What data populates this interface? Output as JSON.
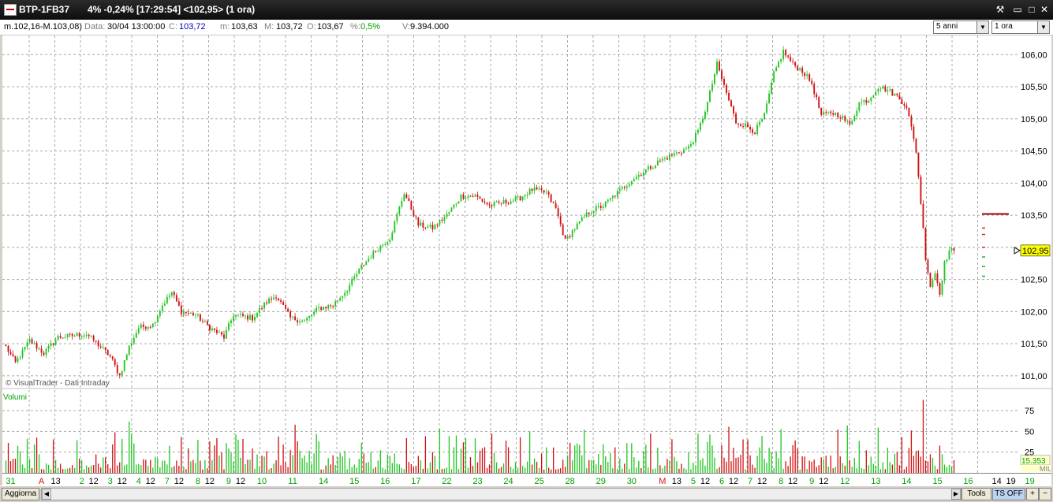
{
  "window": {
    "symbol": "BTP-1FB37",
    "quote": "4% -0,24% [17:29:54]  <102,95> (1 ora)",
    "minimize": "▭",
    "maximize": "□",
    "close": "✕",
    "tool": "⚒"
  },
  "info": {
    "range": "m.102,16-M.103,08)",
    "data_label": "Data:",
    "data_value": "30/04 13:00:00",
    "c_label": "C:",
    "c_value": "103,72",
    "m_label": "m:",
    "m_value": "103,63",
    "M_label": "M:",
    "M_value": "103,72",
    "o_label": "O:",
    "o_value": "103,67",
    "pct_label": "%:",
    "pct_value": "0,5%",
    "v_label": "V:",
    "v_value": "9.394.000"
  },
  "selects": {
    "period": "5 anni",
    "interval": "1 ora"
  },
  "bottom": {
    "aggiorna": "Aggiorna",
    "tools": "Tools",
    "ts_off": "TS OFF",
    "plus": "+",
    "minus": "−"
  },
  "colors": {
    "up": "#22c422",
    "down": "#d01010",
    "grid": "#a8a8a8",
    "price_tag": "#ffff00",
    "volumi_label": "#00a000"
  },
  "chart_data": [
    {
      "type": "candlestick",
      "title": "",
      "watermark": "© VisualTrader - Dati Intraday",
      "ylim": [
        100.9,
        106.2
      ],
      "yticks": [
        "101,00",
        "101,50",
        "102,00",
        "102,50",
        "103,00",
        "103,50",
        "104,00",
        "104,50",
        "105,00",
        "105,50",
        "106,00"
      ],
      "yticks_values": [
        101.0,
        101.5,
        102.0,
        102.5,
        103.0,
        103.5,
        104.0,
        104.5,
        105.0,
        105.5,
        106.0
      ],
      "last_price_label": "102,95",
      "last_price": 102.95,
      "anchors": [
        {
          "bar": 0,
          "price": 101.45
        },
        {
          "bar": 4,
          "price": 101.2
        },
        {
          "bar": 10,
          "price": 101.55
        },
        {
          "bar": 16,
          "price": 101.35
        },
        {
          "bar": 22,
          "price": 101.6
        },
        {
          "bar": 34,
          "price": 101.65
        },
        {
          "bar": 40,
          "price": 101.45
        },
        {
          "bar": 44,
          "price": 101.3
        },
        {
          "bar": 48,
          "price": 101.0
        },
        {
          "bar": 52,
          "price": 101.45
        },
        {
          "bar": 56,
          "price": 101.75
        },
        {
          "bar": 62,
          "price": 101.8
        },
        {
          "bar": 66,
          "price": 102.1
        },
        {
          "bar": 70,
          "price": 102.3
        },
        {
          "bar": 74,
          "price": 102.0
        },
        {
          "bar": 80,
          "price": 101.95
        },
        {
          "bar": 86,
          "price": 101.75
        },
        {
          "bar": 92,
          "price": 101.6
        },
        {
          "bar": 96,
          "price": 101.95
        },
        {
          "bar": 104,
          "price": 101.9
        },
        {
          "bar": 110,
          "price": 102.15
        },
        {
          "bar": 114,
          "price": 102.25
        },
        {
          "bar": 120,
          "price": 101.9
        },
        {
          "bar": 126,
          "price": 101.85
        },
        {
          "bar": 132,
          "price": 102.05
        },
        {
          "bar": 138,
          "price": 102.1
        },
        {
          "bar": 144,
          "price": 102.35
        },
        {
          "bar": 150,
          "price": 102.7
        },
        {
          "bar": 156,
          "price": 102.95
        },
        {
          "bar": 162,
          "price": 103.15
        },
        {
          "bar": 168,
          "price": 103.85
        },
        {
          "bar": 174,
          "price": 103.35
        },
        {
          "bar": 180,
          "price": 103.3
        },
        {
          "bar": 186,
          "price": 103.5
        },
        {
          "bar": 192,
          "price": 103.8
        },
        {
          "bar": 198,
          "price": 103.8
        },
        {
          "bar": 204,
          "price": 103.65
        },
        {
          "bar": 210,
          "price": 103.7
        },
        {
          "bar": 216,
          "price": 103.75
        },
        {
          "bar": 222,
          "price": 103.9
        },
        {
          "bar": 228,
          "price": 103.85
        },
        {
          "bar": 232,
          "price": 103.6
        },
        {
          "bar": 236,
          "price": 103.1
        },
        {
          "bar": 240,
          "price": 103.3
        },
        {
          "bar": 246,
          "price": 103.55
        },
        {
          "bar": 252,
          "price": 103.65
        },
        {
          "bar": 258,
          "price": 103.85
        },
        {
          "bar": 264,
          "price": 104.05
        },
        {
          "bar": 270,
          "price": 104.2
        },
        {
          "bar": 276,
          "price": 104.35
        },
        {
          "bar": 282,
          "price": 104.45
        },
        {
          "bar": 288,
          "price": 104.55
        },
        {
          "bar": 292,
          "price": 104.8
        },
        {
          "bar": 296,
          "price": 105.25
        },
        {
          "bar": 300,
          "price": 105.85
        },
        {
          "bar": 304,
          "price": 105.4
        },
        {
          "bar": 308,
          "price": 104.95
        },
        {
          "bar": 312,
          "price": 104.9
        },
        {
          "bar": 316,
          "price": 104.8
        },
        {
          "bar": 320,
          "price": 105.05
        },
        {
          "bar": 324,
          "price": 105.7
        },
        {
          "bar": 328,
          "price": 106.05
        },
        {
          "bar": 332,
          "price": 105.85
        },
        {
          "bar": 336,
          "price": 105.75
        },
        {
          "bar": 340,
          "price": 105.55
        },
        {
          "bar": 344,
          "price": 105.05
        },
        {
          "bar": 348,
          "price": 105.1
        },
        {
          "bar": 352,
          "price": 105.05
        },
        {
          "bar": 356,
          "price": 104.9
        },
        {
          "bar": 360,
          "price": 105.25
        },
        {
          "bar": 364,
          "price": 105.3
        },
        {
          "bar": 368,
          "price": 105.5
        },
        {
          "bar": 372,
          "price": 105.45
        },
        {
          "bar": 376,
          "price": 105.35
        },
        {
          "bar": 380,
          "price": 105.2
        },
        {
          "bar": 384,
          "price": 104.5
        },
        {
          "bar": 386,
          "price": 103.7
        },
        {
          "bar": 388,
          "price": 102.85
        },
        {
          "bar": 390,
          "price": 102.4
        },
        {
          "bar": 392,
          "price": 102.6
        },
        {
          "bar": 394,
          "price": 102.3
        },
        {
          "bar": 396,
          "price": 102.75
        },
        {
          "bar": 398,
          "price": 102.95
        },
        {
          "bar": 400,
          "price": 102.95
        }
      ],
      "bar_count": 401,
      "pending_markers": [
        103.52,
        103.3,
        103.2,
        103.0,
        102.85,
        102.7,
        102.55
      ]
    },
    {
      "type": "bar",
      "title": "Volumi",
      "ylim": [
        0,
        95
      ],
      "yticks": [
        "25",
        "50",
        "75"
      ],
      "yticks_values": [
        25,
        50,
        75
      ],
      "unit_label": "MIL",
      "last_value_label": "15.353",
      "last_value": 15.353,
      "peak_value": 88,
      "peak_bar": 387
    }
  ],
  "x_axis": {
    "labels": [
      {
        "bar": 2,
        "text": "31",
        "color": "#00a000"
      },
      {
        "bar": 15,
        "text": "A",
        "color": "#d01010"
      },
      {
        "bar": 21,
        "text": "13",
        "color": "#000000"
      },
      {
        "bar": 32,
        "text": "2",
        "color": "#00a000"
      },
      {
        "bar": 37,
        "text": "12",
        "color": "#000000"
      },
      {
        "bar": 44,
        "text": "3",
        "color": "#00a000"
      },
      {
        "bar": 49,
        "text": "12",
        "color": "#000000"
      },
      {
        "bar": 56,
        "text": "4",
        "color": "#00a000"
      },
      {
        "bar": 61,
        "text": "12",
        "color": "#000000"
      },
      {
        "bar": 68,
        "text": "7",
        "color": "#00a000"
      },
      {
        "bar": 73,
        "text": "12",
        "color": "#000000"
      },
      {
        "bar": 81,
        "text": "8",
        "color": "#00a000"
      },
      {
        "bar": 86,
        "text": "12",
        "color": "#000000"
      },
      {
        "bar": 94,
        "text": "9",
        "color": "#00a000"
      },
      {
        "bar": 99,
        "text": "12",
        "color": "#000000"
      },
      {
        "bar": 108,
        "text": "10",
        "color": "#00a000"
      },
      {
        "bar": 121,
        "text": "11",
        "color": "#00a000"
      },
      {
        "bar": 134,
        "text": "14",
        "color": "#00a000"
      },
      {
        "bar": 147,
        "text": "15",
        "color": "#00a000"
      },
      {
        "bar": 160,
        "text": "16",
        "color": "#00a000"
      },
      {
        "bar": 173,
        "text": "17",
        "color": "#00a000"
      },
      {
        "bar": 186,
        "text": "22",
        "color": "#00a000"
      },
      {
        "bar": 199,
        "text": "23",
        "color": "#00a000"
      },
      {
        "bar": 212,
        "text": "24",
        "color": "#00a000"
      },
      {
        "bar": 225,
        "text": "25",
        "color": "#00a000"
      },
      {
        "bar": 238,
        "text": "28",
        "color": "#00a000"
      },
      {
        "bar": 251,
        "text": "29",
        "color": "#00a000"
      },
      {
        "bar": 264,
        "text": "30",
        "color": "#00a000"
      },
      {
        "bar": 277,
        "text": "M",
        "color": "#d01010"
      },
      {
        "bar": 283,
        "text": "13",
        "color": "#000000"
      },
      {
        "bar": 290,
        "text": "5",
        "color": "#00a000"
      },
      {
        "bar": 295,
        "text": "12",
        "color": "#000000"
      },
      {
        "bar": 302,
        "text": "6",
        "color": "#00a000"
      },
      {
        "bar": 307,
        "text": "12",
        "color": "#000000"
      },
      {
        "bar": 314,
        "text": "7",
        "color": "#00a000"
      },
      {
        "bar": 319,
        "text": "12",
        "color": "#000000"
      },
      {
        "bar": 327,
        "text": "8",
        "color": "#00a000"
      },
      {
        "bar": 332,
        "text": "12",
        "color": "#000000"
      },
      {
        "bar": 340,
        "text": "9",
        "color": "#00a000"
      },
      {
        "bar": 345,
        "text": "12",
        "color": "#000000"
      },
      {
        "bar": 354,
        "text": "12",
        "color": "#00a000"
      },
      {
        "bar": 367,
        "text": "13",
        "color": "#00a000"
      },
      {
        "bar": 380,
        "text": "14",
        "color": "#00a000"
      },
      {
        "bar": 393,
        "text": "15",
        "color": "#00a000"
      },
      {
        "bar": 406,
        "text": "16",
        "color": "#00a000"
      },
      {
        "bar": 418,
        "text": "14",
        "color": "#000000"
      },
      {
        "bar": 424,
        "text": "19",
        "color": "#000000"
      },
      {
        "bar": 432,
        "text": "19",
        "color": "#00a000"
      }
    ]
  }
}
